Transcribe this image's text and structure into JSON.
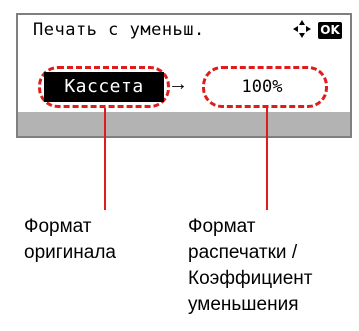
{
  "screen": {
    "title": "Печать с уменьш.",
    "nav_icon": "◆",
    "ok_label": "OK",
    "source_value": "Кассета",
    "arrow": "→",
    "ratio_value": "100%"
  },
  "callouts": {
    "original_size": [
      "Формат",
      "оригинала"
    ],
    "output_size": [
      "Формат",
      "распечатки /",
      "Коэффициент",
      "уменьшения"
    ]
  },
  "colors": {
    "accent": "#e01b1b",
    "panel_border": "#7f7f7f",
    "status_bar": "#b3b3b3"
  }
}
